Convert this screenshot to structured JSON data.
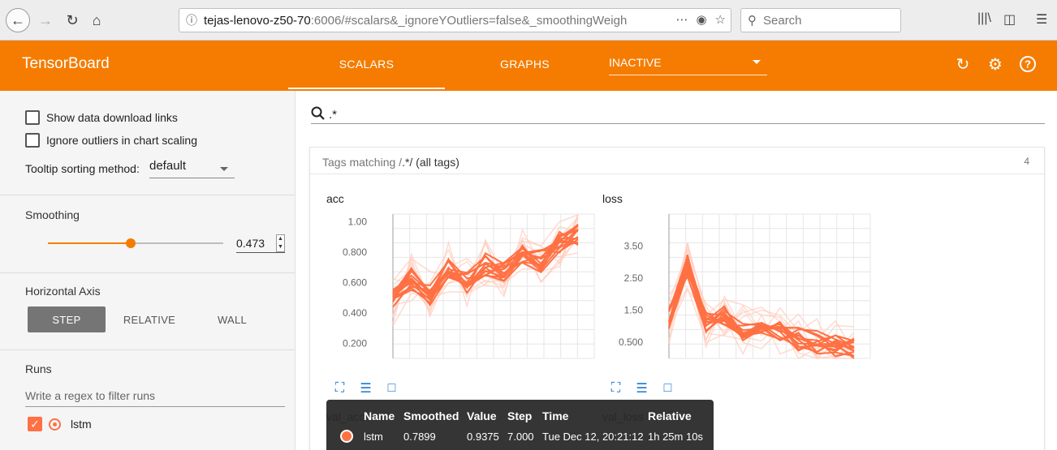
{
  "browser": {
    "url_host": "tejas-lenovo-z50-70",
    "url_rest": ":6006/#scalars&_ignoreYOutliers=false&_smoothingWeigh",
    "search_placeholder": "Search"
  },
  "header": {
    "brand": "TensorBoard",
    "tabs": [
      "SCALARS",
      "GRAPHS"
    ],
    "active_tab": "SCALARS",
    "inactive_select": "INACTIVE",
    "accent_color": "#f57c00"
  },
  "sidebar": {
    "show_download_links": "Show data download links",
    "ignore_outliers": "Ignore outliers in chart scaling",
    "tooltip_sort_label": "Tooltip sorting method:",
    "tooltip_sort_value": "default",
    "smoothing_title": "Smoothing",
    "smoothing_value": "0.473",
    "smoothing_fraction": 0.473,
    "horizontal_axis_title": "Horizontal Axis",
    "axis_buttons": [
      "STEP",
      "RELATIVE",
      "WALL"
    ],
    "axis_selected": "STEP",
    "runs_title": "Runs",
    "runs_filter_placeholder": "Write a regex to filter runs",
    "runs": [
      {
        "name": "lstm",
        "checked": true,
        "color": "#ff7043"
      }
    ]
  },
  "main": {
    "regex_value": ".*",
    "card": {
      "prefix": "Tags matching /",
      "regex": ".*",
      "suffix": "/ (all tags)",
      "count": "4"
    }
  },
  "charts": [
    {
      "title": "acc",
      "y_ticks": [
        "1.00",
        "0.800",
        "0.600",
        "0.400",
        "0.200"
      ]
    },
    {
      "title": "loss",
      "y_ticks": [
        "3.50",
        "2.50",
        "1.50",
        "0.500"
      ]
    }
  ],
  "below_charts": [
    "val_acc",
    "val_loss"
  ],
  "tooltip": {
    "headers": [
      "Name",
      "Smoothed",
      "Value",
      "Step",
      "Time",
      "Relative"
    ],
    "row": {
      "name": "lstm",
      "smoothed": "0.7899",
      "value": "0.9375",
      "step": "7.000",
      "time": "Tue Dec 12, 20:21:12",
      "relative": "1h 25m 10s"
    }
  },
  "chart_data": [
    {
      "type": "line",
      "title": "acc",
      "ylim": [
        0.1,
        1.05
      ],
      "yticks": [
        0.2,
        0.4,
        0.6,
        0.8,
        1.0
      ],
      "series": [
        {
          "values": [
            0.48,
            0.62,
            0.52,
            0.7,
            0.6,
            0.72,
            0.66,
            0.8,
            0.74,
            0.86,
            0.92
          ]
        }
      ]
    },
    {
      "type": "line",
      "title": "loss",
      "ylim": [
        0,
        4.5
      ],
      "yticks": [
        0.5,
        1.5,
        2.5,
        3.5
      ],
      "series": [
        {
          "values": [
            1.2,
            2.9,
            1.1,
            1.4,
            0.9,
            1.0,
            0.8,
            0.6,
            0.5,
            0.4,
            0.3
          ]
        }
      ]
    }
  ]
}
